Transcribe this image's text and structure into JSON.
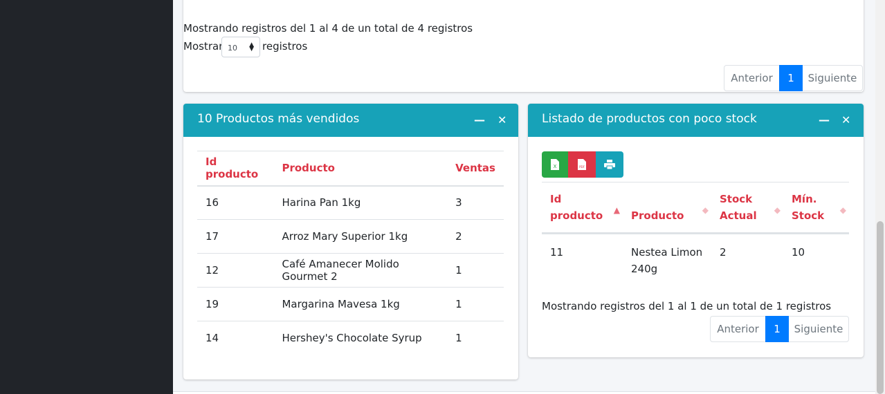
{
  "top_section": {
    "info": "Mostrando registros del 1 al 4 de un total de 4 registros",
    "show_label": "Mostrar",
    "show_value": "10",
    "records_label": "registros",
    "pager": {
      "prev": "Anterior",
      "page": "1",
      "next": "Siguiente"
    }
  },
  "top_products": {
    "title": "10 Productos más vendidos",
    "columns": [
      "Id producto",
      "Producto",
      "Ventas"
    ],
    "rows": [
      [
        "16",
        "Harina Pan 1kg",
        "3"
      ],
      [
        "17",
        "Arroz Mary Superior 1kg",
        "2"
      ],
      [
        "12",
        "Café Amanecer Molido Gourmet 2",
        "1"
      ],
      [
        "19",
        "Margarina Mavesa 1kg",
        "1"
      ],
      [
        "14",
        "Hershey's Chocolate Syrup",
        "1"
      ]
    ]
  },
  "low_stock": {
    "title": "Listado de productos con poco stock",
    "buttons": {
      "excel": "excel-icon",
      "pdf": "pdf-icon",
      "print": "print-icon"
    },
    "columns": [
      "Id producto",
      "Producto",
      "Stock Actual",
      "Mín. Stock"
    ],
    "rows": [
      [
        "11",
        "Nestea Limon 240g",
        "2",
        "10"
      ]
    ],
    "info": "Mostrando registros del 1 al 1 de un total de 1 registros",
    "pager": {
      "prev": "Anterior",
      "page": "1",
      "next": "Siguiente"
    }
  },
  "colors": {
    "header": "#17a2b8",
    "accent": "#007bff",
    "th_text": "#dc3545",
    "excel": "#28a745",
    "pdf": "#dc3545"
  }
}
